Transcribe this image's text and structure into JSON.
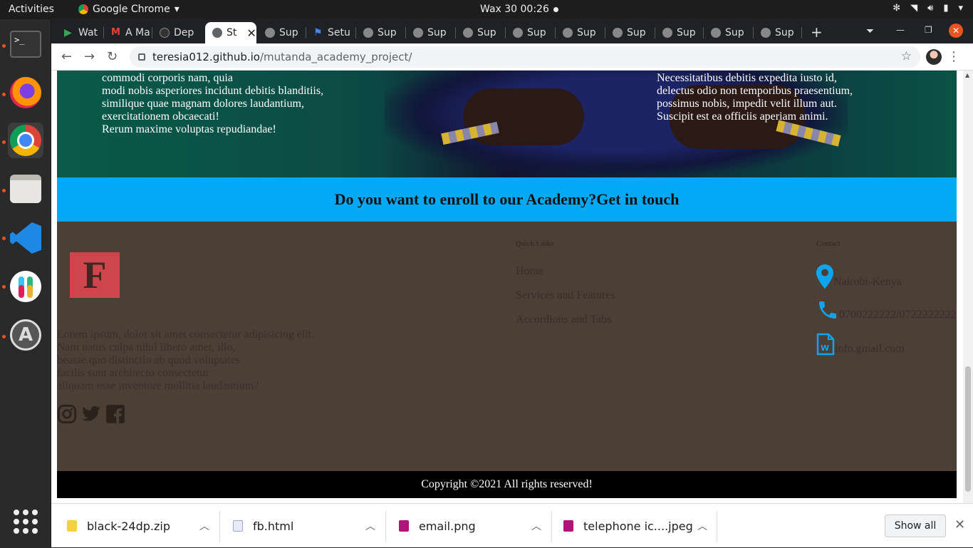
{
  "topbar": {
    "activities": "Activities",
    "app_name": "Google Chrome",
    "clock": "Wax 30  00:26"
  },
  "dock": {
    "items": [
      "terminal-icon",
      "firefox-icon",
      "chrome-icon",
      "files-icon",
      "vscode-icon",
      "slack-icon",
      "anbox-icon",
      "app-grid-icon"
    ]
  },
  "browser": {
    "tabs": [
      {
        "label": "Wat"
      },
      {
        "label": "A Ma"
      },
      {
        "label": "Dep"
      },
      {
        "label": "St"
      },
      {
        "label": "Sup"
      },
      {
        "label": "Setu"
      },
      {
        "label": "Sup"
      },
      {
        "label": "Sup"
      },
      {
        "label": "Sup"
      },
      {
        "label": "Sup"
      },
      {
        "label": "Sup"
      },
      {
        "label": "Sup"
      },
      {
        "label": "Sup"
      },
      {
        "label": "Sup"
      },
      {
        "label": "Sup"
      }
    ],
    "url_host": "teresia012.github.io",
    "url_path": "/mutanda_academy_project/"
  },
  "page": {
    "hero_left": [
      "commodi corporis nam, quia",
      "modi nobis asperiores incidunt debitis blanditiis,",
      "similique quae magnam dolores laudantium,",
      "exercitationem obcaecati!",
      "Rerum maxime voluptas repudiandae!"
    ],
    "hero_right": [
      "Necessitatibus debitis expedita iusto id,",
      "delectus odio non temporibus praesentium,",
      "possimus nobis, impedit velit illum aut.",
      "Suscipit est ea officiis aperiam animi."
    ],
    "cta": "Do you want to enroll to our Academy?Get in touch",
    "footer": {
      "logo_letter": "F",
      "about": [
        "Lorem ipsum, dolor sit amet consectetur adipisicing elit.",
        "Nam natus culpa nihil libero amet, illo,",
        "beatae quo distinctio ab quod voluptates",
        "facilis sunt architecto consectetur",
        "aliquam esse inventore mollitia laudantium?"
      ],
      "social_icons": [
        "instagram-icon",
        "twitter-icon",
        "facebook-icon"
      ],
      "quick_links_heading": "Quick Links",
      "quick_links": [
        "Home",
        "Services and Features",
        "Accordions and Tabs"
      ],
      "contact_heading": "Contact",
      "contact": {
        "location": "Nairobi-Kenya",
        "phone": "0700222222/0722222222",
        "email": "info.gmail.com"
      },
      "accent_color": "#0ea5ef"
    },
    "copyright": "Copyright ©2021 All rights reserved!"
  },
  "downloads": {
    "items": [
      {
        "name": "black-24dp.zip",
        "color": "#f4d03f"
      },
      {
        "name": "fb.html",
        "color": "#9aa6d8"
      },
      {
        "name": "email.png",
        "color": "#b0137a"
      },
      {
        "name": "telephone ic....jpeg",
        "color": "#b0137a"
      }
    ],
    "show_all": "Show all"
  }
}
